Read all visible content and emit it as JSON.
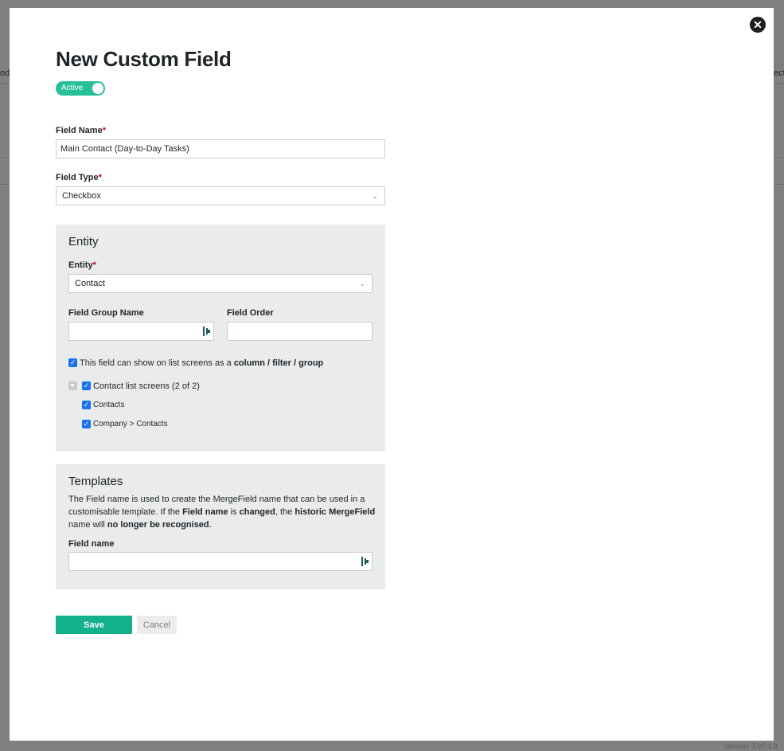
{
  "background": {
    "left_fragment": "ode",
    "right_fragment": "ect",
    "version": "Version: 7.07.1   9"
  },
  "modal": {
    "close_glyph": "✕",
    "title": "New Custom Field",
    "active_toggle": {
      "label": "Active",
      "on": true
    },
    "field_name": {
      "label": "Field Name",
      "required_mark": "*",
      "value": "Main Contact (Day-to-Day Tasks)"
    },
    "field_type": {
      "label": "Field Type",
      "required_mark": "*",
      "value": "Checkbox"
    },
    "entity_panel": {
      "title": "Entity",
      "entity": {
        "label": "Entity",
        "required_mark": "*",
        "value": "Contact"
      },
      "field_group_name": {
        "label": "Field Group Name",
        "value": ""
      },
      "field_order": {
        "label": "Field Order",
        "value": ""
      },
      "show_on_list": {
        "checked": true,
        "text_prefix": "This field can show on list screens as a ",
        "text_bold": "column / filter / group"
      },
      "contact_list_screens": {
        "checked": true,
        "label": "Contact list screens (2 of 2)"
      },
      "screens": [
        {
          "checked": true,
          "label": "Contacts"
        },
        {
          "checked": true,
          "label": "Company > Contacts"
        }
      ]
    },
    "templates_panel": {
      "title": "Templates",
      "desc_1": "The Field name is used to create the MergeField name that can be used in a customisable template. If the ",
      "desc_b1": "Field name",
      "desc_2": " is ",
      "desc_b2": "changed",
      "desc_3": ", the ",
      "desc_b3": "historic MergeField",
      "desc_4": " name will ",
      "desc_b4": "no longer be recognised",
      "desc_5": ".",
      "field_name": {
        "label": "Field name",
        "value": ""
      }
    },
    "buttons": {
      "save": "Save",
      "cancel": "Cancel"
    }
  },
  "colors": {
    "accent": "#13b08e",
    "toggle": "#27bf9a",
    "checkbox": "#1a73e8",
    "panel_bg": "#e9ebec",
    "required": "#d0021b"
  },
  "icons": {
    "close": "close-icon",
    "select": "chevron-down-icon",
    "addon": "field-picker-icon",
    "checkbox": "checkmark-icon",
    "expander": "caret-down-icon"
  }
}
